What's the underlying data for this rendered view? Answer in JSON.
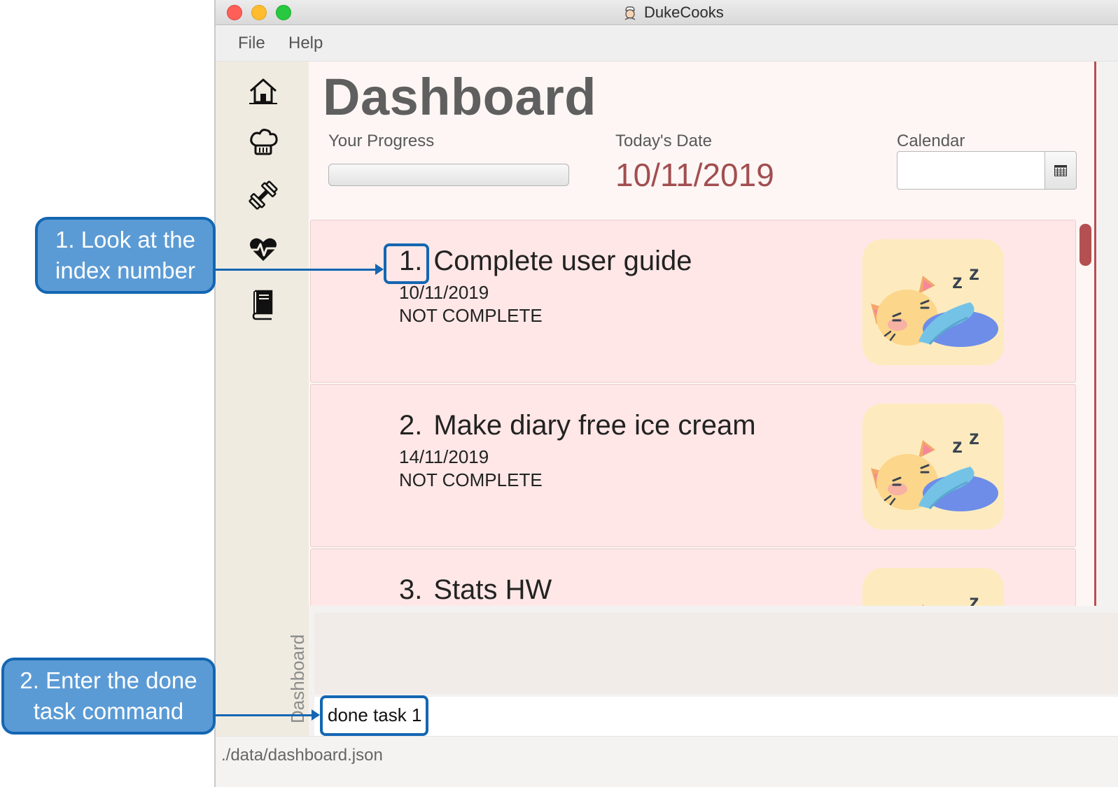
{
  "window": {
    "title": "DukeCooks",
    "icon": "chef-face-icon"
  },
  "menu": {
    "items": [
      "File",
      "Help"
    ]
  },
  "sidebar": {
    "nav": [
      {
        "icon": "home-icon"
      },
      {
        "icon": "chef-hat-icon"
      },
      {
        "icon": "dumbbell-icon"
      },
      {
        "icon": "heartbeat-icon"
      },
      {
        "icon": "book-icon"
      }
    ],
    "vertical_label": "Dashboard"
  },
  "dashboard": {
    "title": "Dashboard",
    "progress": {
      "label": "Your Progress",
      "value": 0
    },
    "today": {
      "label": "Today's Date",
      "value": "10/11/2019"
    },
    "calendar": {
      "label": "Calendar",
      "value": "",
      "button_icon": "calendar-icon"
    }
  },
  "tasks": [
    {
      "index": "1.",
      "name": "Complete user guide",
      "date": "10/11/2019",
      "status": "NOT COMPLETE",
      "image": "sleeping-cat"
    },
    {
      "index": "2.",
      "name": "Make diary free ice cream",
      "date": "14/11/2019",
      "status": "NOT COMPLETE",
      "image": "sleeping-cat"
    },
    {
      "index": "3.",
      "name": "Stats HW",
      "date": "",
      "status": "",
      "image": "sleeping-cat"
    }
  ],
  "result_display": "",
  "command": {
    "value": "done task 1"
  },
  "status_bar": {
    "path": "./data/dashboard.json"
  },
  "annotations": {
    "step1": [
      "1. Look at the",
      "index number"
    ],
    "step2": [
      "2. Enter the done",
      "task command"
    ]
  },
  "colors": {
    "accent": "#b45051",
    "date": "#a24e50",
    "card": "#fee7e6",
    "callout": "#5b9bd5",
    "callout_border": "#1466b2"
  }
}
